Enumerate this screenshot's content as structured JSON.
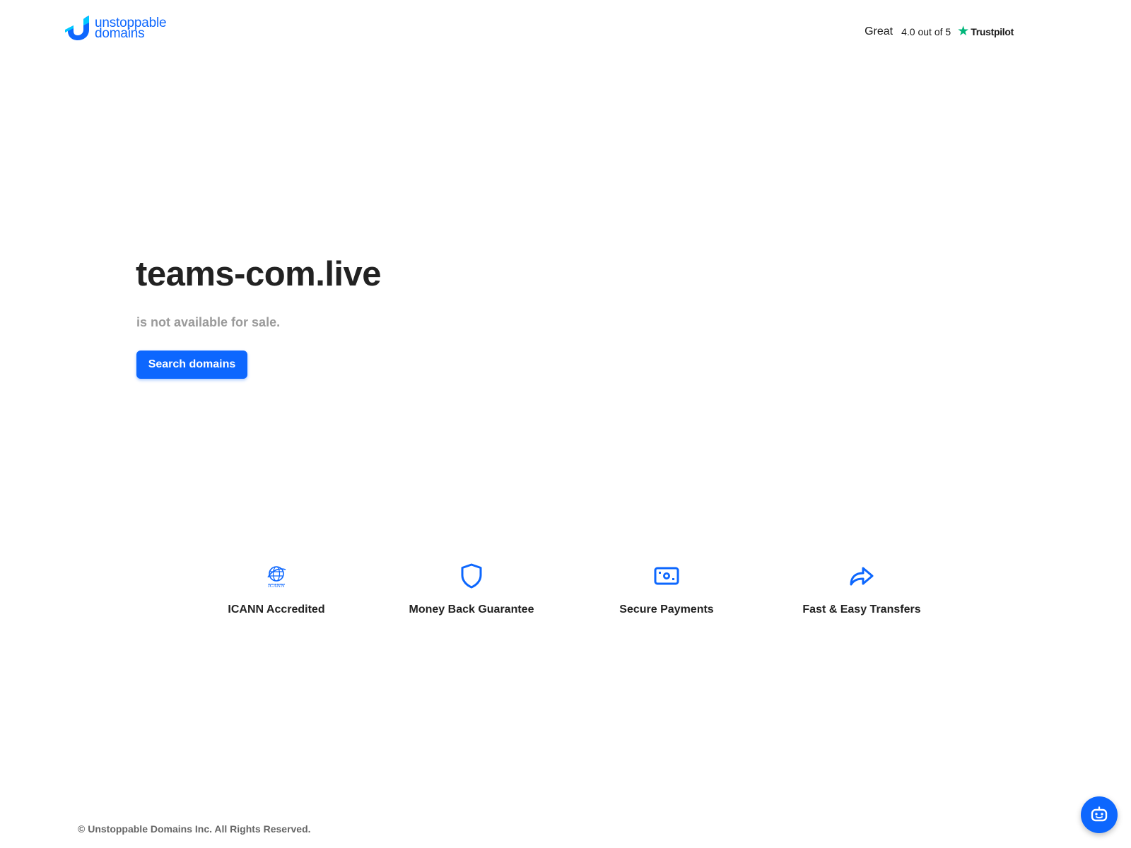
{
  "header": {
    "logo": {
      "line1": "unstoppable",
      "line2": "domains"
    },
    "trustpilot": {
      "rating_word": "Great",
      "score_text": "4.0 out of 5",
      "brand": "Trustpilot",
      "star_color": "#00b67a"
    }
  },
  "hero": {
    "domain": "teams-com.live",
    "status": "is not available for sale.",
    "cta_label": "Search domains"
  },
  "features": [
    {
      "label": "ICANN Accredited",
      "icon": "icann-globe-icon"
    },
    {
      "label": "Money Back Guarantee",
      "icon": "shield-icon"
    },
    {
      "label": "Secure Payments",
      "icon": "cash-icon"
    },
    {
      "label": "Fast & Easy Transfers",
      "icon": "share-arrow-icon"
    }
  ],
  "footer": {
    "copyright": "© Unstoppable Domains Inc. All Rights Reserved.",
    "chat_icon": "chat-bot-icon"
  },
  "colors": {
    "accent": "#0d67fe",
    "muted": "#9a9a9a",
    "text": "#222222"
  }
}
